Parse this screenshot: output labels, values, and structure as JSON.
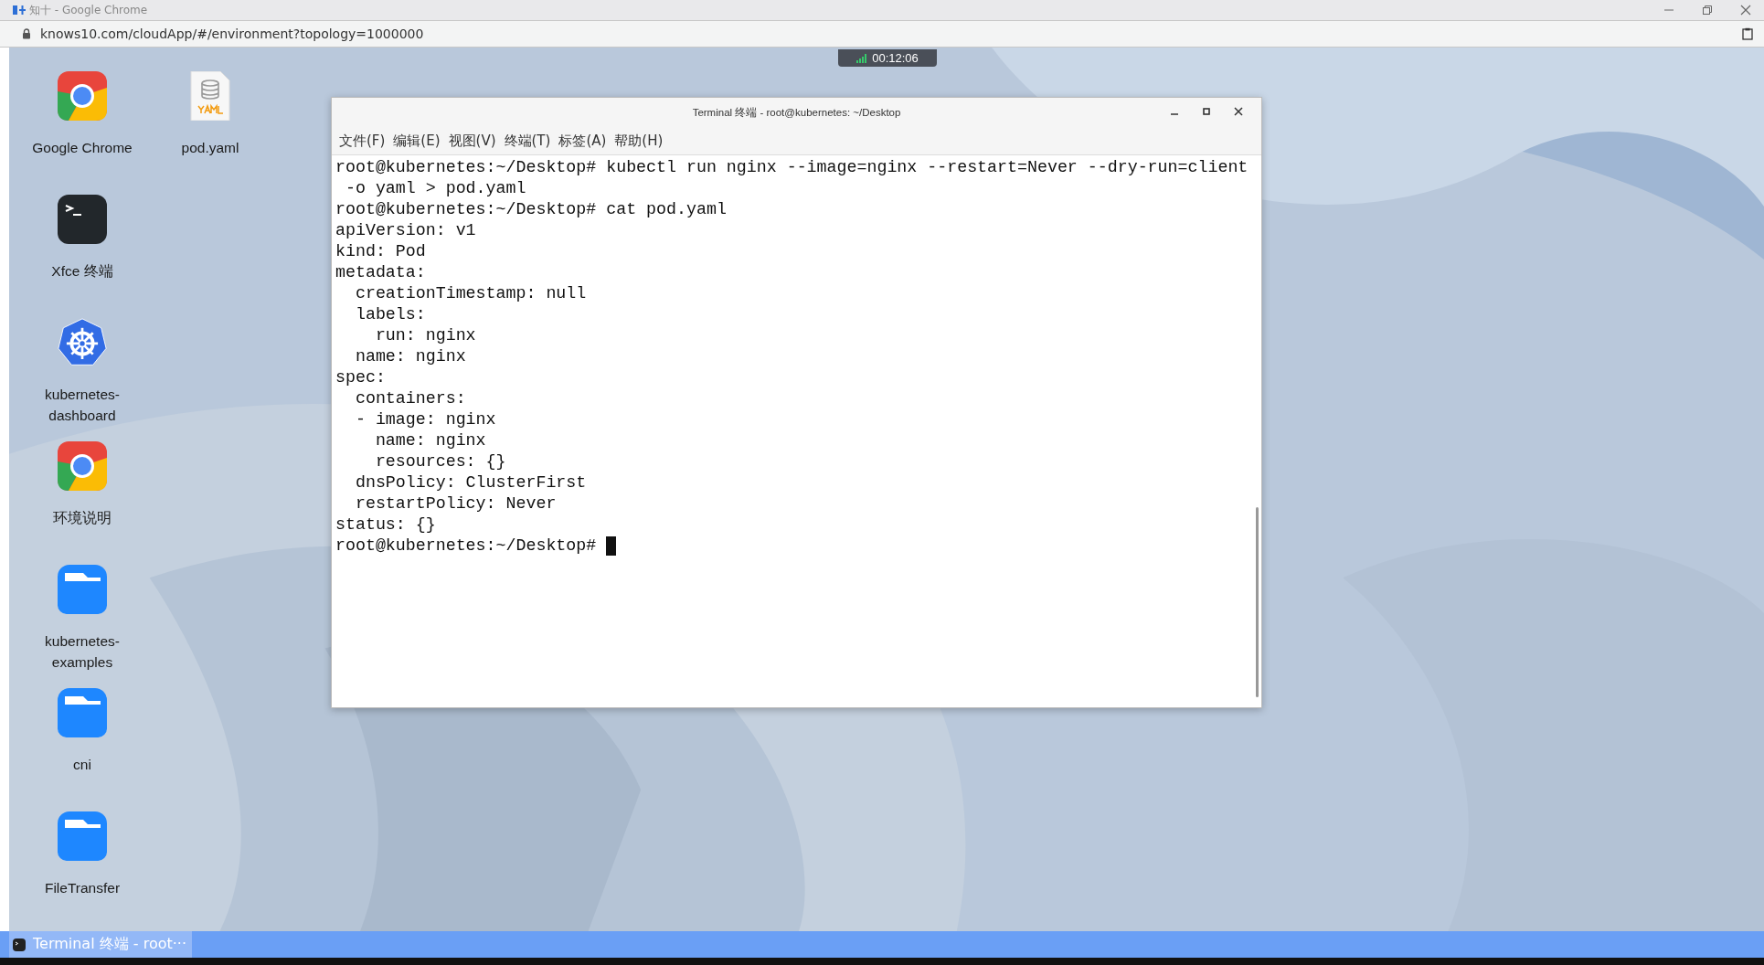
{
  "browser": {
    "title": "知十 - Google Chrome",
    "url": "knows10.com/cloudApp/#/environment?topology=1000000"
  },
  "timer": "00:12:06",
  "icon_columns": [
    [
      {
        "label": "Google Chrome",
        "kind": "chrome"
      },
      {
        "label": "Xfce 终端",
        "kind": "terminal"
      },
      {
        "label": "kubernetes-dashboard",
        "kind": "kubernetes"
      },
      {
        "label": "环境说明",
        "kind": "chrome"
      },
      {
        "label": "kubernetes-examples",
        "kind": "folder"
      },
      {
        "label": "cni",
        "kind": "folder"
      },
      {
        "label": "FileTransfer",
        "kind": "folder"
      }
    ],
    [
      {
        "label": "pod.yaml",
        "kind": "yaml"
      }
    ]
  ],
  "terminal": {
    "title": "Terminal 终端 - root@kubernetes: ~/Desktop",
    "menu": [
      "文件(F)",
      "编辑(E)",
      "视图(V)",
      "终端(T)",
      "标签(A)",
      "帮助(H)"
    ],
    "lines": [
      "root@kubernetes:~/Desktop# kubectl run nginx --image=nginx --restart=Never --dry-run=client",
      " -o yaml > pod.yaml",
      "root@kubernetes:~/Desktop# cat pod.yaml",
      "apiVersion: v1",
      "kind: Pod",
      "metadata:",
      "  creationTimestamp: null",
      "  labels:",
      "    run: nginx",
      "  name: nginx",
      "spec:",
      "  containers:",
      "  - image: nginx",
      "    name: nginx",
      "    resources: {}",
      "  dnsPolicy: ClusterFirst",
      "  restartPolicy: Never",
      "status: {}",
      "root@kubernetes:~/Desktop# "
    ],
    "cursor": true
  },
  "taskbar": {
    "tasks": [
      {
        "label": "Terminal 终端 - root···",
        "selected": true
      }
    ]
  }
}
